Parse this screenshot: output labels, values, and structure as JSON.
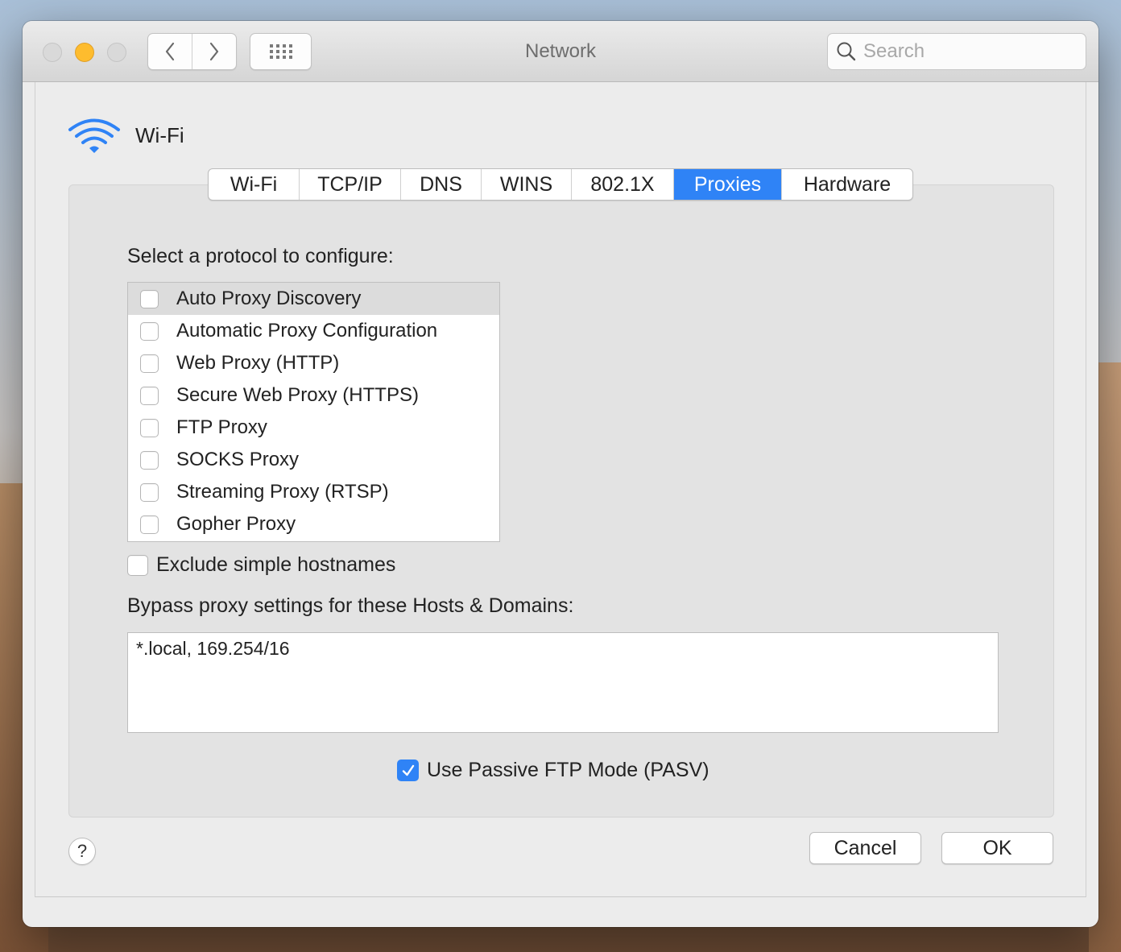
{
  "window": {
    "title": "Network"
  },
  "toolbar": {
    "search_placeholder": "Search"
  },
  "interface": {
    "name": "Wi-Fi"
  },
  "tabs": [
    {
      "label": "Wi-Fi",
      "active": false
    },
    {
      "label": "TCP/IP",
      "active": false
    },
    {
      "label": "DNS",
      "active": false
    },
    {
      "label": "WINS",
      "active": false
    },
    {
      "label": "802.1X",
      "active": false
    },
    {
      "label": "Proxies",
      "active": true
    },
    {
      "label": "Hardware",
      "active": false
    }
  ],
  "proxies": {
    "select_label": "Select a protocol to configure:",
    "protocols": [
      {
        "label": "Auto Proxy Discovery",
        "checked": false,
        "selected": true
      },
      {
        "label": "Automatic Proxy Configuration",
        "checked": false,
        "selected": false
      },
      {
        "label": "Web Proxy (HTTP)",
        "checked": false,
        "selected": false
      },
      {
        "label": "Secure Web Proxy (HTTPS)",
        "checked": false,
        "selected": false
      },
      {
        "label": "FTP Proxy",
        "checked": false,
        "selected": false
      },
      {
        "label": "SOCKS Proxy",
        "checked": false,
        "selected": false
      },
      {
        "label": "Streaming Proxy (RTSP)",
        "checked": false,
        "selected": false
      },
      {
        "label": "Gopher Proxy",
        "checked": false,
        "selected": false
      }
    ],
    "exclude_simple_label": "Exclude simple hostnames",
    "exclude_simple_checked": false,
    "bypass_label": "Bypass proxy settings for these Hosts & Domains:",
    "bypass_value": "*.local, 169.254/16",
    "pasv_label": "Use Passive FTP Mode (PASV)",
    "pasv_checked": true
  },
  "footer": {
    "help_label": "?",
    "cancel_label": "Cancel",
    "ok_label": "OK"
  },
  "colors": {
    "accent": "#2f83f6",
    "minimize": "#febc2e",
    "wifi_icon": "#2f83f6"
  }
}
